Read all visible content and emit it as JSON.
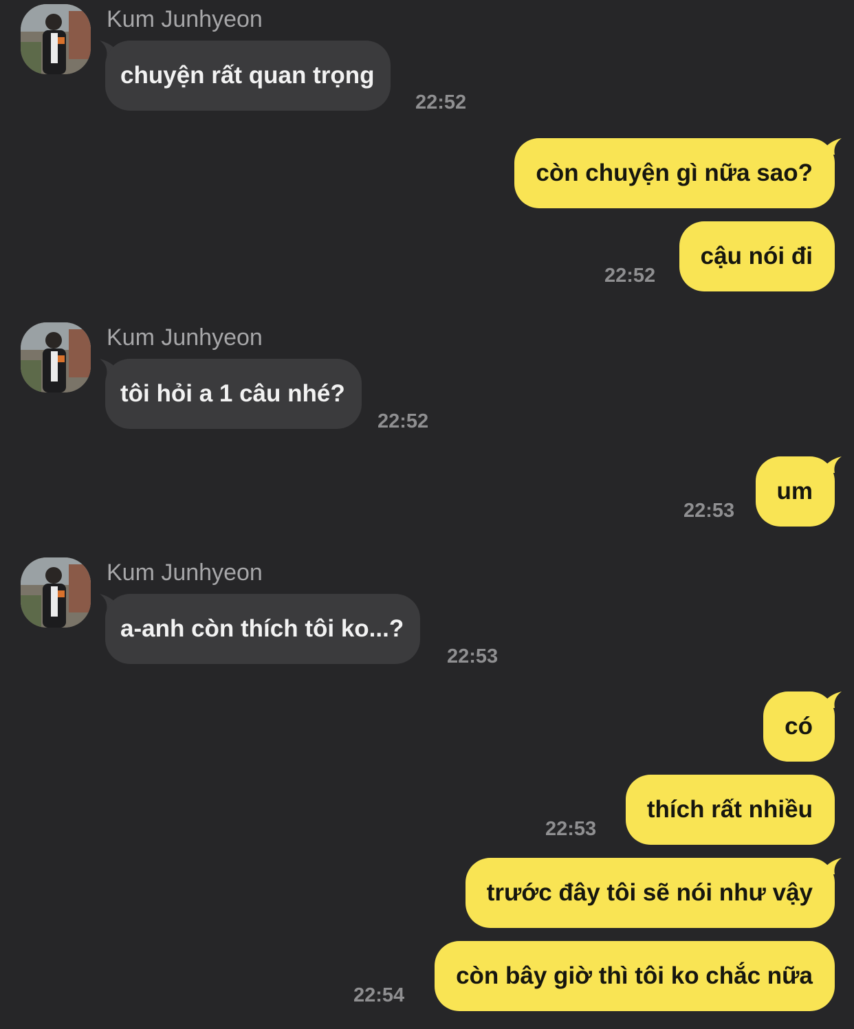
{
  "sender_name": "Kum Junhyeon",
  "messages": [
    {
      "text": "chuyện rất quan trọng",
      "time": "22:52"
    },
    {
      "text": "còn chuyện gì nữa sao?"
    },
    {
      "text": "cậu nói đi",
      "time": "22:52"
    },
    {
      "text": "tôi hỏi a 1 câu nhé?",
      "time": "22:52"
    },
    {
      "text": "um",
      "time": "22:53"
    },
    {
      "text": "a-anh còn thích tôi ko...?",
      "time": "22:53"
    },
    {
      "text": "có"
    },
    {
      "text": "thích rất nhiều",
      "time": "22:53"
    },
    {
      "text": "trước đây tôi sẽ nói như vậy"
    },
    {
      "text": "còn bây giờ thì tôi ko chắc nữa",
      "time": "22:54"
    }
  ]
}
